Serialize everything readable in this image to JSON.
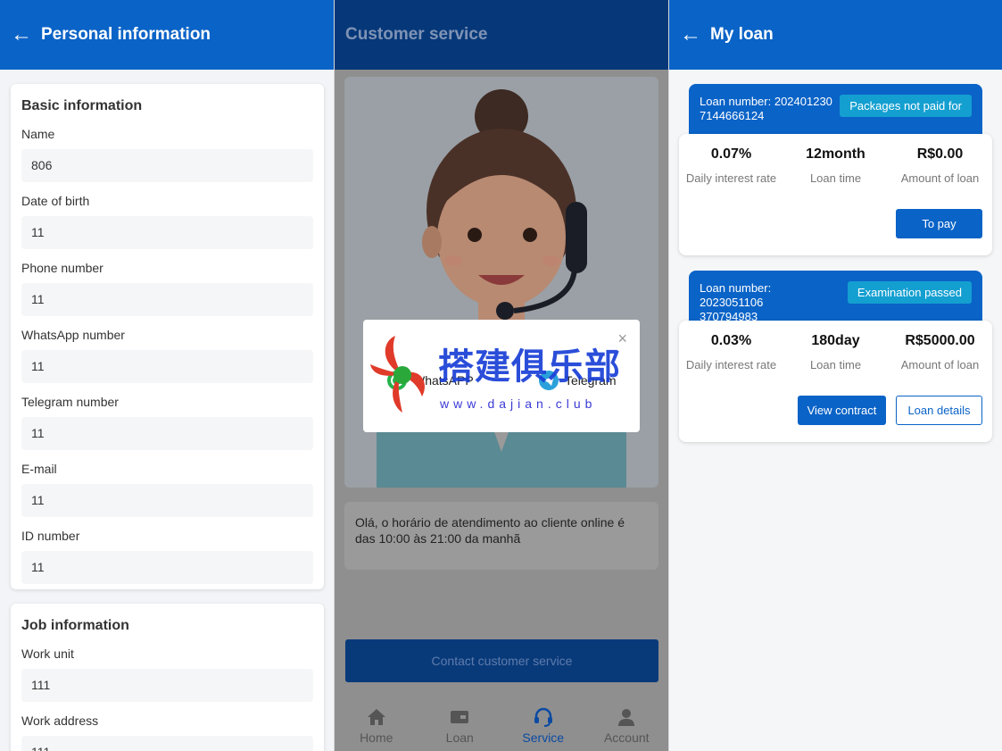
{
  "personal": {
    "title": "Personal information",
    "basic": {
      "title": "Basic information",
      "fields": [
        {
          "label": "Name",
          "value": "806"
        },
        {
          "label": "Date of birth",
          "value": "11"
        },
        {
          "label": "Phone number",
          "value": "11"
        },
        {
          "label": "WhatsApp number",
          "value": "11"
        },
        {
          "label": "Telegram number",
          "value": "11"
        },
        {
          "label": "E-mail",
          "value": "11"
        },
        {
          "label": "ID number",
          "value": "11"
        }
      ]
    },
    "job": {
      "title": "Job information",
      "fields": [
        {
          "label": "Work unit",
          "value": "111"
        },
        {
          "label": "Work address",
          "value": "111"
        }
      ]
    }
  },
  "service": {
    "title": "Customer service",
    "message": "Olá, o horário de atendimento ao cliente online é das 10:00 às 21:00 da manhã",
    "contact_button": "Contact customer service",
    "modal": {
      "close": "×",
      "options": [
        "WhatsAPP",
        "Telegram"
      ],
      "watermark": "搭建俱乐部",
      "watermark_url": "www.dajian.club"
    },
    "tabs": [
      {
        "label": "Home",
        "icon": "home-icon"
      },
      {
        "label": "Loan",
        "icon": "wallet-icon"
      },
      {
        "label": "Service",
        "icon": "headset-icon",
        "active": true
      },
      {
        "label": "Account",
        "icon": "user-icon"
      }
    ]
  },
  "myloan": {
    "title": "My loan",
    "loans": [
      {
        "number": "Loan number: 2024012307144666124",
        "number_line1": "Loan number: 202401230",
        "number_line2": "7144666124",
        "status": "Packages not paid for",
        "rate": "0.07%",
        "rate_label": "Daily interest rate",
        "time": "12month",
        "time_label": "Loan time",
        "amount": "R$0.00",
        "amount_label": "Amount of loan",
        "buttons": [
          "To pay"
        ]
      },
      {
        "number": "Loan number: 2023051106370794983",
        "number_line1": "Loan number: 2023051106",
        "number_line2": "370794983",
        "status": "Examination passed",
        "rate": "0.03%",
        "rate_label": "Daily interest rate",
        "time": "180day",
        "time_label": "Loan time",
        "amount": "R$5000.00",
        "amount_label": "Amount of loan",
        "buttons": [
          "View contract",
          "Loan details"
        ]
      }
    ]
  },
  "colors": {
    "primary": "#0a63c7",
    "badge": "#149fd1",
    "overlay_header": "#063879"
  }
}
